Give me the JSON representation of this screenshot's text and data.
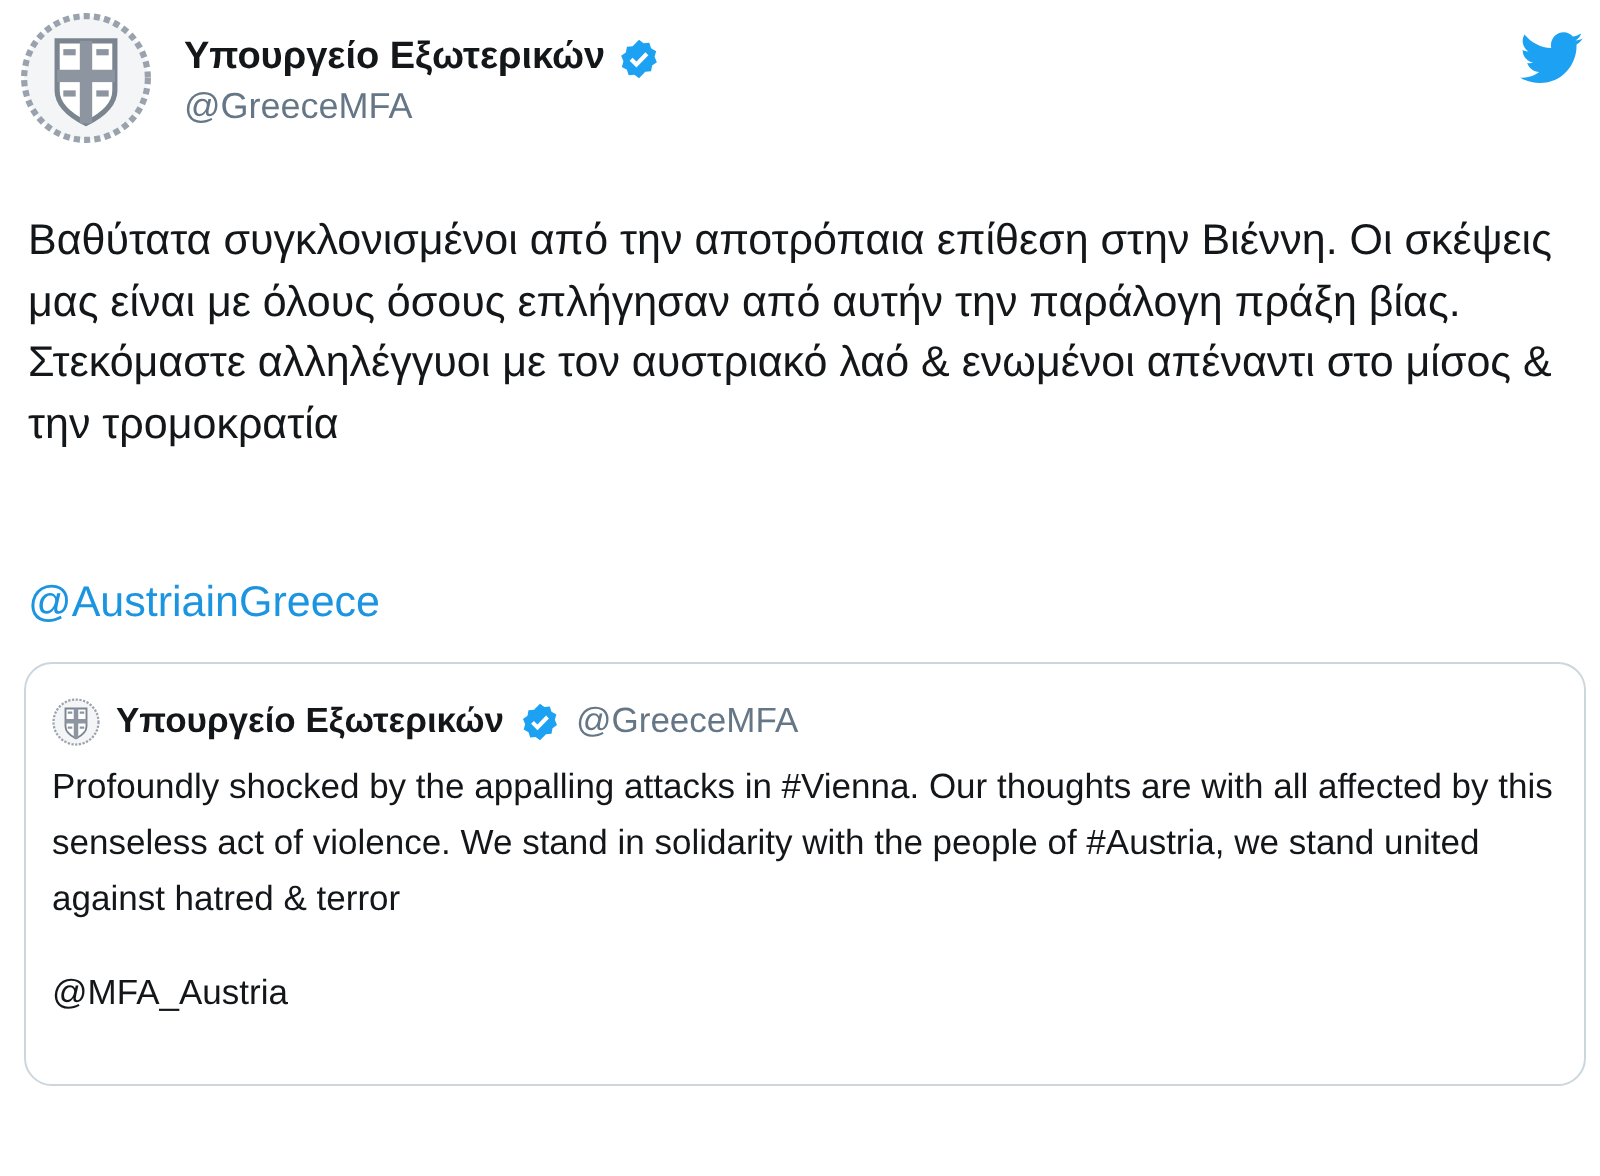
{
  "tweet": {
    "author": {
      "name": "Υπουργείο Εξωτερικών",
      "handle": "@GreeceMFA",
      "verified": true
    },
    "text": "Βαθύτατα συγκλονισμένοι από την αποτρόπαια επίθεση στην Βιέννη. Οι σκέψεις μας είναι με όλους όσους επλήγησαν από αυτήν την παράλογη πράξη βίας. Στεκόμαστε αλληλέγγυοι με τον αυστριακό λαό & ενωμένοι απέναντι στο μίσος & την τρομοκρατία",
    "mention": "@AustriainGreece",
    "quoted": {
      "author": {
        "name": "Υπουργείο Εξωτερικών",
        "handle": "@GreeceMFA",
        "verified": true
      },
      "text": "Profoundly shocked by the appalling attacks in #Vienna. Our thoughts are with all affected by this senseless act of violence. We stand in solidarity with the people of #Austria, we stand united against hatred & terror",
      "mention": "@MFA_Austria"
    }
  }
}
